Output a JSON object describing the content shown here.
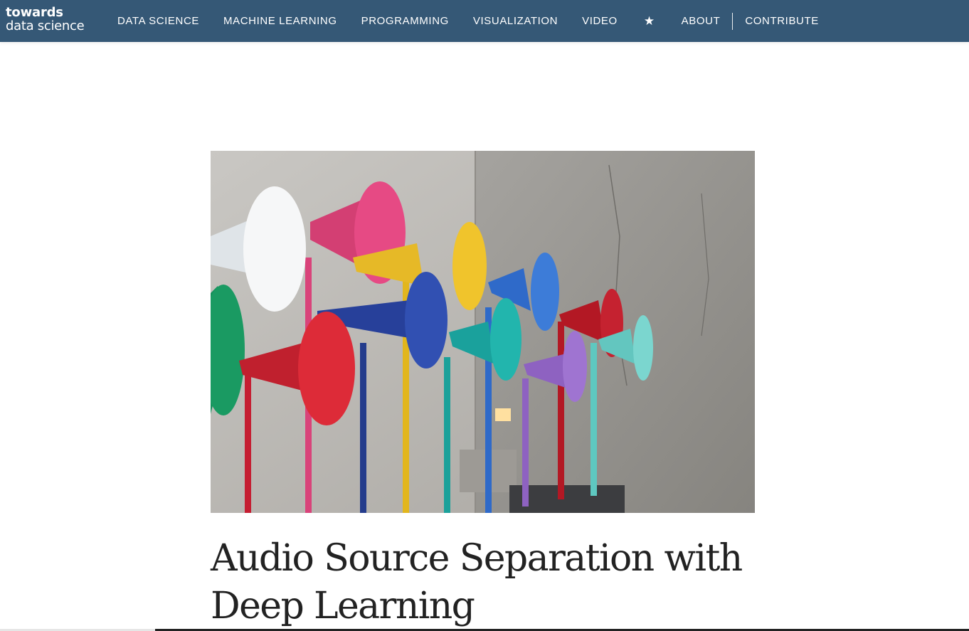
{
  "brand": {
    "line1": "towards",
    "line2": "data science"
  },
  "nav": {
    "items": [
      "DATA SCIENCE",
      "MACHINE LEARNING",
      "PROGRAMMING",
      "VISUALIZATION",
      "VIDEO"
    ],
    "star": "★",
    "about": "ABOUT",
    "contribute": "CONTRIBUTE"
  },
  "article": {
    "title": "Audio Source Separation with Deep Learning",
    "hero_image": "colorful-horn-speakers-photo"
  },
  "colors": {
    "topbar": "#355876",
    "title_text": "#222222"
  }
}
